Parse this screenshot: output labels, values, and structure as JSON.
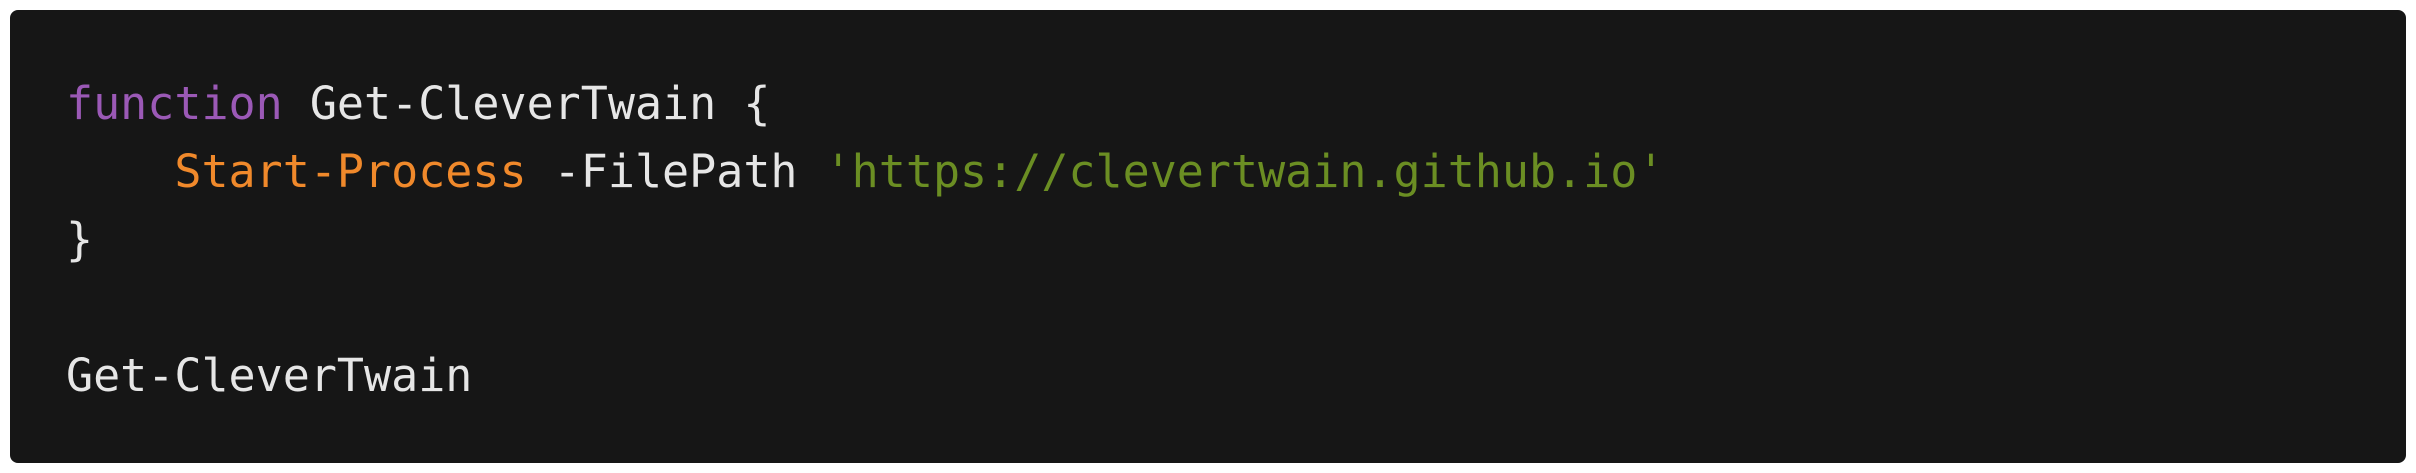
{
  "colors": {
    "background": "#161616",
    "keyword": "#9b59b6",
    "command": "#f0892b",
    "string": "#6b8e23",
    "text": "#e6e6e6"
  },
  "code": {
    "line1": {
      "keyword": "function",
      "name": " Get-CleverTwain {"
    },
    "line2": {
      "indent": "    ",
      "command": "Start-Process",
      "param": " -FilePath ",
      "string": "'https://clevertwain.github.io'"
    },
    "line3": {
      "text": "}"
    },
    "line4": {
      "text": ""
    },
    "line5": {
      "text": "Get-CleverTwain"
    }
  }
}
